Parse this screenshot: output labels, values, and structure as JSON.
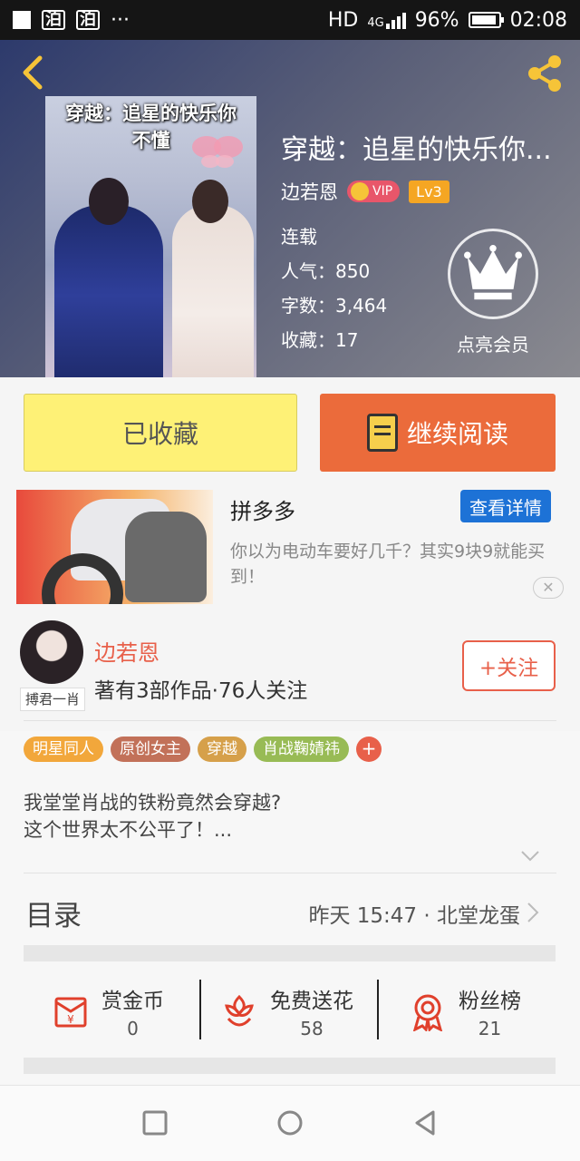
{
  "status_bar": {
    "network": "HD",
    "net_type": "4G",
    "battery": "96%",
    "battery_level": 0.96,
    "time": "02:08"
  },
  "header": {
    "cover_title": "穿越：追星的快乐你不懂",
    "book_title": "穿越：追星的快乐你...",
    "author": "边若恩",
    "vip_badge": "VIP",
    "level": "Lv3",
    "status": "连载",
    "popularity": "人气：850",
    "word_count": "字数：3,464",
    "favorites": "收藏：17",
    "member_label": "点亮会员"
  },
  "actions": {
    "favorited_label": "已收藏",
    "continue_label": "继续阅读"
  },
  "ad": {
    "name": "拼多多",
    "cta": "查看详情",
    "description": "你以为电动车要好几千？其实9块9就能买到！",
    "close": "✕"
  },
  "author_section": {
    "avatar_tag": "搏君一肖",
    "name": "边若恩",
    "info": "著有3部作品·76人关注",
    "follow_label": "+关注"
  },
  "tags": [
    {
      "label": "明星同人",
      "color": "#f2a73b"
    },
    {
      "label": "原创女主",
      "color": "#c27159"
    },
    {
      "label": "穿越",
      "color": "#d6a04a"
    },
    {
      "label": "肖战鞠婧祎",
      "color": "#98bb55"
    }
  ],
  "tag_more": "+",
  "description": {
    "line1": "我堂堂肖战的铁粉竟然会穿越?",
    "line2": "这个世界太不公平了！..."
  },
  "toc": {
    "title": "目录",
    "latest": "昨天 15:47 · 北堂龙蛋"
  },
  "rewards": [
    {
      "label": "赏金币",
      "value": "0",
      "icon": "coin-envelope-icon"
    },
    {
      "label": "免费送花",
      "value": "58",
      "icon": "flower-icon"
    },
    {
      "label": "粉丝榜",
      "value": "21",
      "icon": "medal-icon"
    }
  ],
  "colors": {
    "accent": "#e8604a",
    "favorited_bg": "#fef176",
    "read_bg": "#eb6b3b",
    "ad_button": "#1d72d6"
  }
}
